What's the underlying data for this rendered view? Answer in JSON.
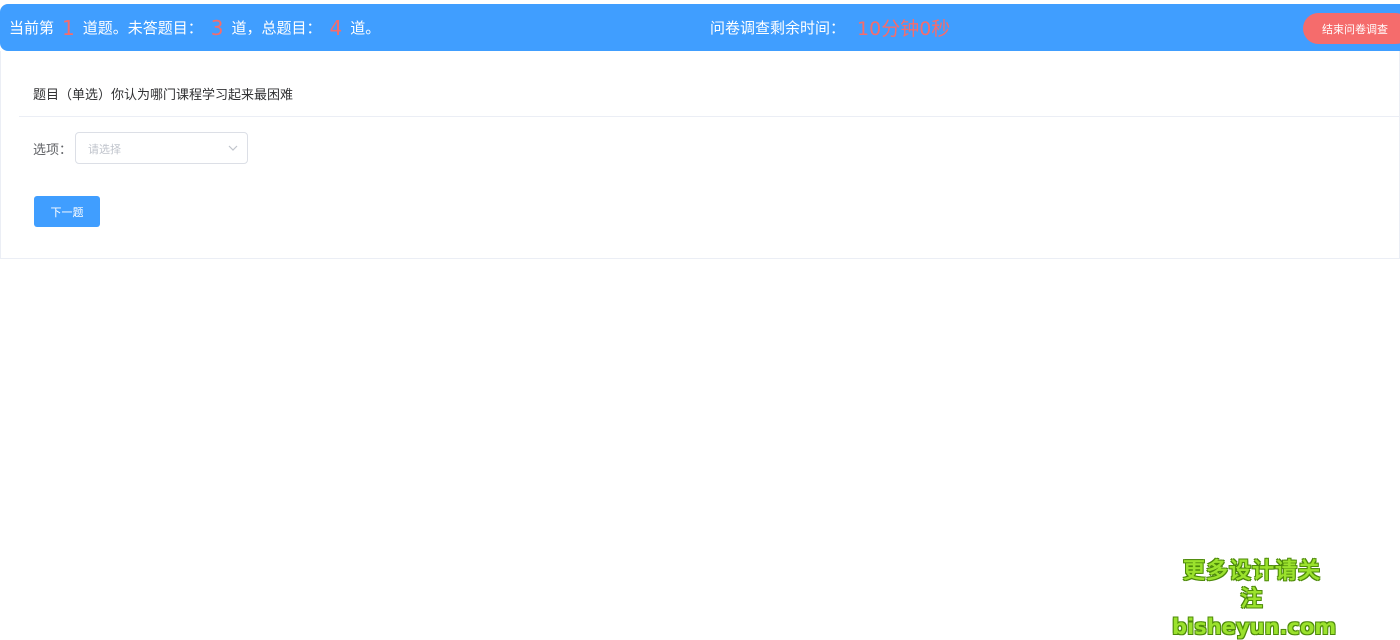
{
  "header": {
    "progress": {
      "prefix": "当前第",
      "current": "1",
      "middle1": "道题。未答题目：",
      "unanswered": "3",
      "middle2": "道，总题目：",
      "total": "4",
      "suffix": "道。"
    },
    "timer": {
      "label": "问卷调查剩余时间：",
      "value": "10分钟0秒"
    },
    "end_button_label": "结束问卷调查"
  },
  "question": {
    "title": "题目（单选）你认为哪门课程学习起来最困难",
    "option_label": "选项：",
    "select_placeholder": "请选择",
    "next_button_label": "下一题"
  },
  "watermark": {
    "line1": "更多设计请关注",
    "line2": "bisheyun.com"
  },
  "colors": {
    "primary": "#409eff",
    "danger": "#f56c6c",
    "watermark": "#9be22d"
  },
  "icons": {
    "select_arrow": "chevron-down-icon"
  }
}
